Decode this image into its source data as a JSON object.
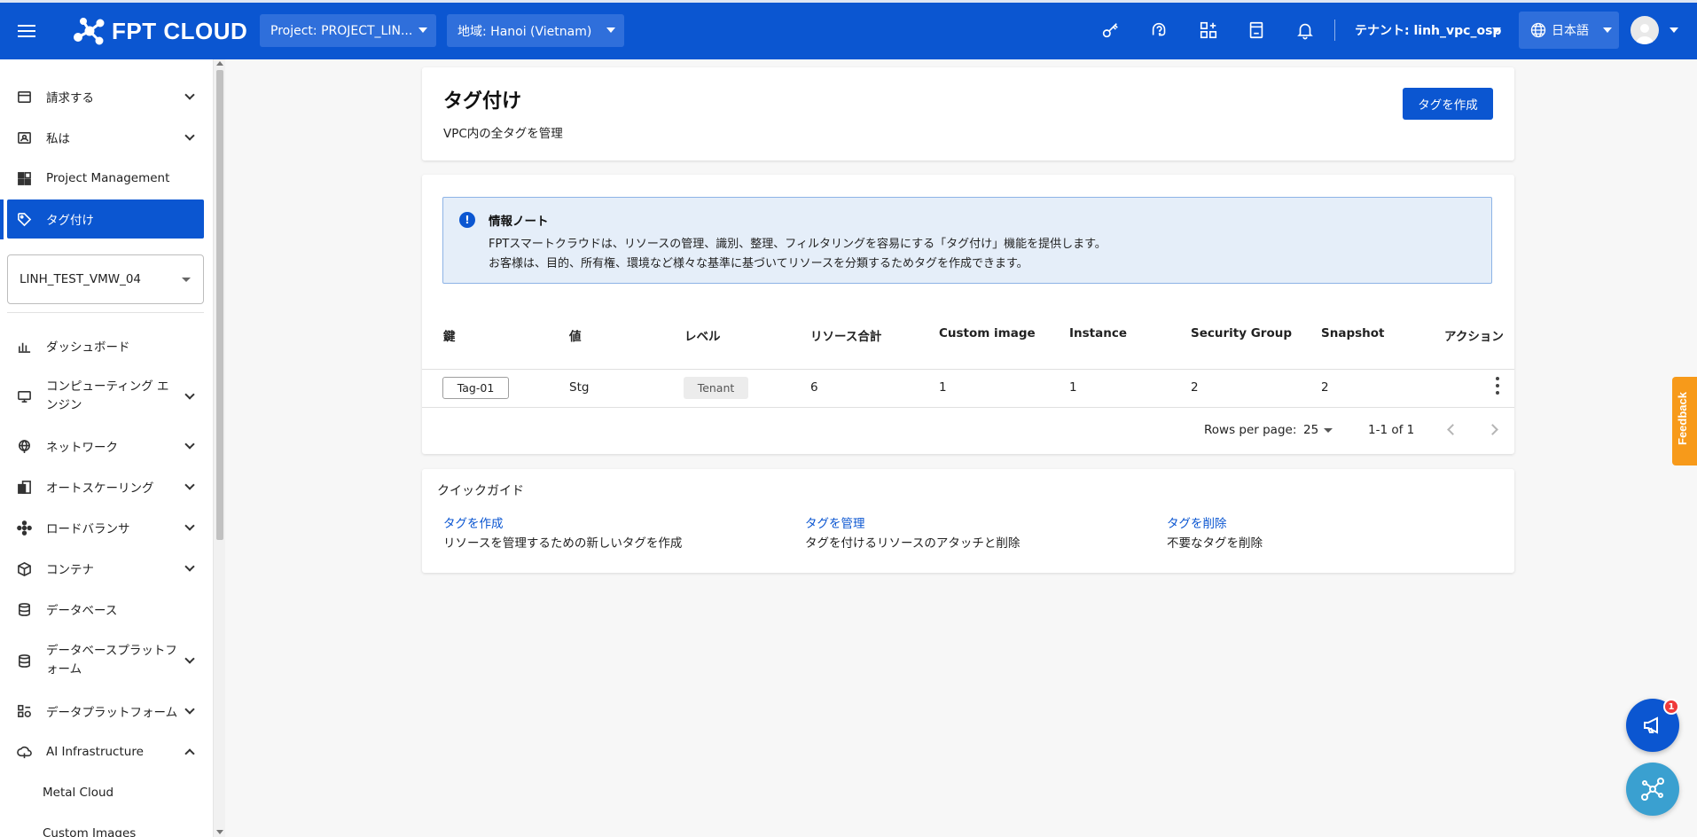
{
  "header": {
    "logo_text": "FPT CLOUD",
    "project_select": "Project: PROJECT_LIN...",
    "region_select": "地域: Hanoi (Vietnam)",
    "tenant": "テナント: linh_vpc_osp",
    "language": "日本語",
    "accent_color": "#0b56d1"
  },
  "sidebar": {
    "items": [
      {
        "label": "請求する",
        "icon": "billing-icon"
      },
      {
        "label": "私は",
        "icon": "profile-icon"
      },
      {
        "label": "Project Management",
        "icon": "project-management-icon"
      },
      {
        "label": "タグ付け",
        "icon": "tag-icon"
      }
    ],
    "project_selector": "LINH_TEST_VMW_04",
    "services": [
      {
        "label": "ダッシュボード",
        "icon": "dashboard-icon"
      },
      {
        "label": "コンピューティング エンジン",
        "icon": "computer-icon"
      },
      {
        "label": "ネットワーク",
        "icon": "network-icon"
      },
      {
        "label": "オートスケーリング",
        "icon": "autoscaling-icon"
      },
      {
        "label": "ロードバランサ",
        "icon": "load-balancer-icon"
      },
      {
        "label": "コンテナ",
        "icon": "container-icon"
      },
      {
        "label": "データベース",
        "icon": "database-icon"
      },
      {
        "label": "データベースプラットフォーム",
        "icon": "database-platform-icon"
      },
      {
        "label": "データプラットフォーム",
        "icon": "data-platform-icon"
      },
      {
        "label": "AI Infrastructure",
        "icon": "ai-infrastructure-icon"
      }
    ],
    "ai_sub_items": [
      "Metal Cloud",
      "Custom Images"
    ]
  },
  "page": {
    "title": "タグ付け",
    "subtitle": "VPC内の全タグを管理",
    "create_button": "タグを作成"
  },
  "info": {
    "title": "情報ノート",
    "line1": "FPTスマートクラウドは、リソースの管理、識別、整理、フィルタリングを容易にする「タグ付け」機能を提供します。",
    "line2": "お客様は、目的、所有権、環境など様々な基準に基づいてリソースを分類するためタグを作成できます。"
  },
  "table": {
    "headers": [
      "鍵",
      "値",
      "レベル",
      "リソース合計",
      "Custom image",
      "Instance",
      "Security Group",
      "Snapshot",
      "アクション"
    ],
    "rows": [
      {
        "key": "Tag-01",
        "value": "Stg",
        "level": "Tenant",
        "total": "6",
        "custom_image": "1",
        "instance": "1",
        "security_group": "2",
        "snapshot": "2"
      }
    ],
    "rows_per_page_label": "Rows per page:",
    "rows_per_page": "25",
    "range": "1-1 of 1"
  },
  "quick_guide": {
    "title": "クイックガイド",
    "items": [
      {
        "link": "タグを作成",
        "desc": "リソースを管理するための新しいタグを作成"
      },
      {
        "link": "タグを管理",
        "desc": "タグを付けるリソースのアタッチと削除"
      },
      {
        "link": "タグを削除",
        "desc": "不要なタグを削除"
      }
    ]
  },
  "floating": {
    "feedback": "Feedback",
    "notification_count": "1"
  }
}
